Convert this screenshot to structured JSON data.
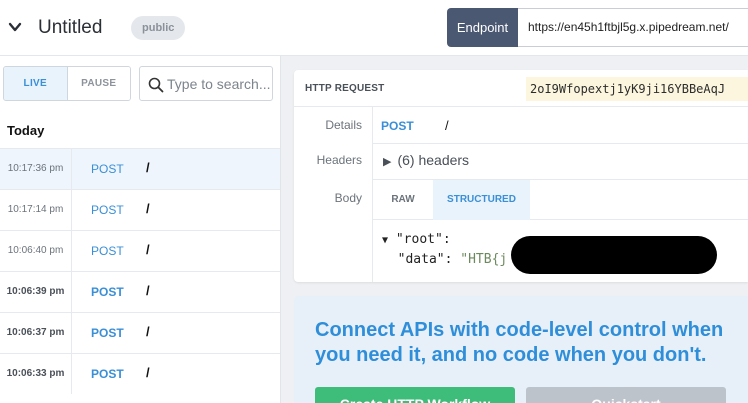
{
  "header": {
    "title": "Untitled",
    "visibility_badge": "public",
    "endpoint_label": "Endpoint",
    "endpoint_url": "https://en45h1ftbjl5g.x.pipedream.net/"
  },
  "left_panel": {
    "mode_toggle": {
      "live": "LIVE",
      "pause": "PAUSE",
      "active": "LIVE"
    },
    "search": {
      "placeholder": "Type to search...",
      "value": ""
    },
    "group_heading": "Today",
    "events": [
      {
        "time": "10:17:36 pm",
        "method": "POST",
        "path": "/",
        "selected": true,
        "bold": false
      },
      {
        "time": "10:17:14 pm",
        "method": "POST",
        "path": "/",
        "selected": false,
        "bold": false
      },
      {
        "time": "10:06:40 pm",
        "method": "POST",
        "path": "/",
        "selected": false,
        "bold": false
      },
      {
        "time": "10:06:39 pm",
        "method": "POST",
        "path": "/",
        "selected": false,
        "bold": true
      },
      {
        "time": "10:06:37 pm",
        "method": "POST",
        "path": "/",
        "selected": false,
        "bold": true
      },
      {
        "time": "10:06:33 pm",
        "method": "POST",
        "path": "/",
        "selected": false,
        "bold": true
      }
    ]
  },
  "request": {
    "section_label": "HTTP REQUEST",
    "request_id": "2oI9Wfopextj1yK9ji16YBBeAqJ",
    "details_label": "Details",
    "method": "POST",
    "path": "/",
    "headers_label": "Headers",
    "headers_summary": "(6) headers",
    "body_label": "Body",
    "tabs": [
      "RAW",
      "STRUCTURED"
    ],
    "active_tab": "STRUCTURED",
    "json_root_key": "\"root\"",
    "json_data_key": "\"data\"",
    "json_data_value": "\"HTB{j"
  },
  "promo": {
    "headline": "Connect APIs with code-level control when you need it, and no code when you don't.",
    "create_button": "Create HTTP Workflow",
    "quickstart_button": "Quickstart"
  },
  "colors": {
    "accent_blue": "#3a8fd6",
    "endpoint_bg": "#4a5872",
    "create_green": "#3ebc7a",
    "id_highlight": "#fbf6dd"
  }
}
